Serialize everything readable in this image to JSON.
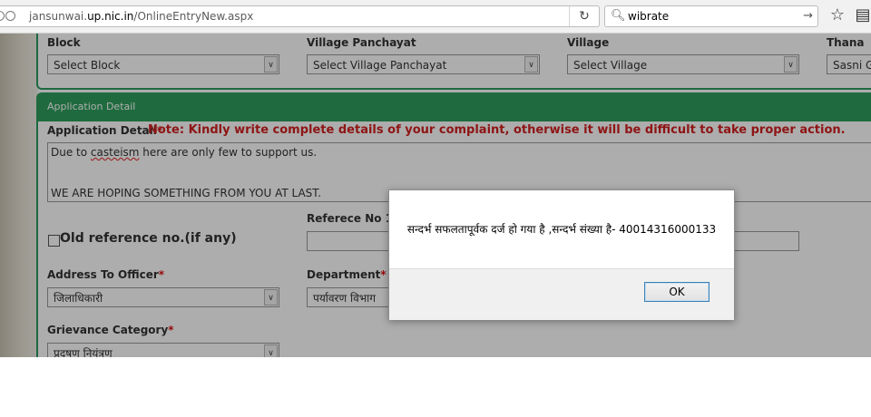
{
  "browser": {
    "url_prefix": "jansunwai.",
    "url_domain": "up.nic.in",
    "url_path": "/OnlineEntryNew.aspx",
    "search_value": "wibrate"
  },
  "location": {
    "block_label": "Block",
    "block_value": "Select Block",
    "village_panchayat_label": "Village Panchayat",
    "village_panchayat_value": "Select Village Panchayat",
    "village_label": "Village",
    "village_value": "Select Village",
    "thana_label": "Thana",
    "thana_value": "Sasni G"
  },
  "application": {
    "section_title": "Application Detail",
    "detail_label": "Application Detail",
    "required_mark": "*",
    "note": "Note: Kindly write complete details of your complaint, otherwise it will be difficult to take proper action.",
    "text_line1_a": "Due to ",
    "text_line1_b": "casteism",
    "text_line1_c": " here are only few to support us.",
    "text_line2": "WE ARE HOPING SOMETHING FROM YOU AT LAST.",
    "old_reference_label": "Old reference no.(if any)",
    "reference_no_label": "Referece No 1",
    "address_label": "Address To Officer",
    "address_value": "जिलाधिकारी",
    "department_label": "Department",
    "department_value": "पर्यावरण विभाग",
    "grievance_label": "Grievance Category",
    "grievance_value": "प्रदूषण नियंत्रण"
  },
  "dialog": {
    "message": "सन्दर्भ सफलतापूर्वक दर्ज हो गया है ,सन्दर्भ संख्या है-  40014316000133",
    "ok_label": "OK"
  },
  "colors": {
    "accent_green": "#2e9e5e",
    "note_red": "#d21f1f"
  }
}
